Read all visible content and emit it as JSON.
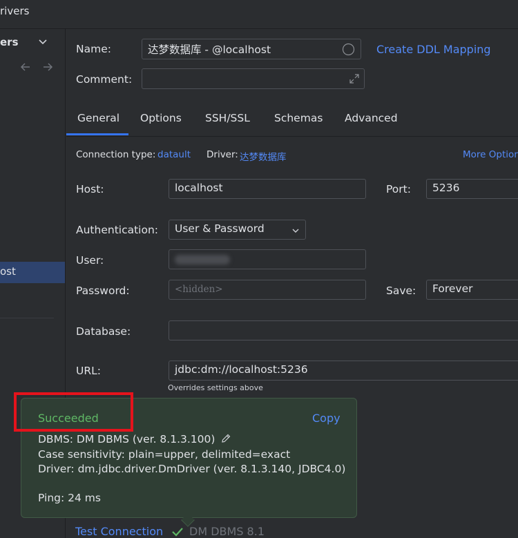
{
  "titlebar": {
    "title": "rivers"
  },
  "sidebar": {
    "header": "ers",
    "selected_item": "ost"
  },
  "form": {
    "name_label": "Name:",
    "name_value": "达梦数据库 - @localhost",
    "create_ddl_link": "Create DDL Mapping",
    "comment_label": "Comment:",
    "comment_value": ""
  },
  "tabs": [
    {
      "label": "General"
    },
    {
      "label": "Options"
    },
    {
      "label": "SSH/SSL"
    },
    {
      "label": "Schemas"
    },
    {
      "label": "Advanced"
    }
  ],
  "general": {
    "connection_type_label": "Connection type:",
    "connection_type_value": "datault",
    "driver_label": "Driver:",
    "driver_value": "达梦数据库",
    "more_options": "More Options",
    "host_label": "Host:",
    "host_value": "localhost",
    "port_label": "Port:",
    "port_value": "5236",
    "auth_label": "Authentication:",
    "auth_value": "User & Password",
    "user_label": "User:",
    "password_label": "Password:",
    "password_placeholder": "<hidden>",
    "save_label": "Save:",
    "save_value": "Forever",
    "database_label": "Database:",
    "database_value": "",
    "url_label": "URL:",
    "url_value": "jdbc:dm://localhost:5236",
    "url_hint": "Overrides settings above"
  },
  "popup": {
    "status": "Succeeded",
    "copy_label": "Copy",
    "dbms_line": "DBMS: DM DBMS (ver. 8.1.3.100)",
    "case_line": "Case sensitivity: plain=upper, delimited=exact",
    "driver_line": "Driver: dm.jdbc.driver.DmDriver (ver. 8.1.3.140, JDBC4.0)",
    "ping_line": "Ping: 24 ms"
  },
  "bottom": {
    "test_connection": "Test Connection",
    "dbms_short": "DM DBMS 8.1"
  },
  "colors": {
    "accent": "#548af7",
    "success": "#5fb865",
    "highlight": "#e5131c"
  }
}
